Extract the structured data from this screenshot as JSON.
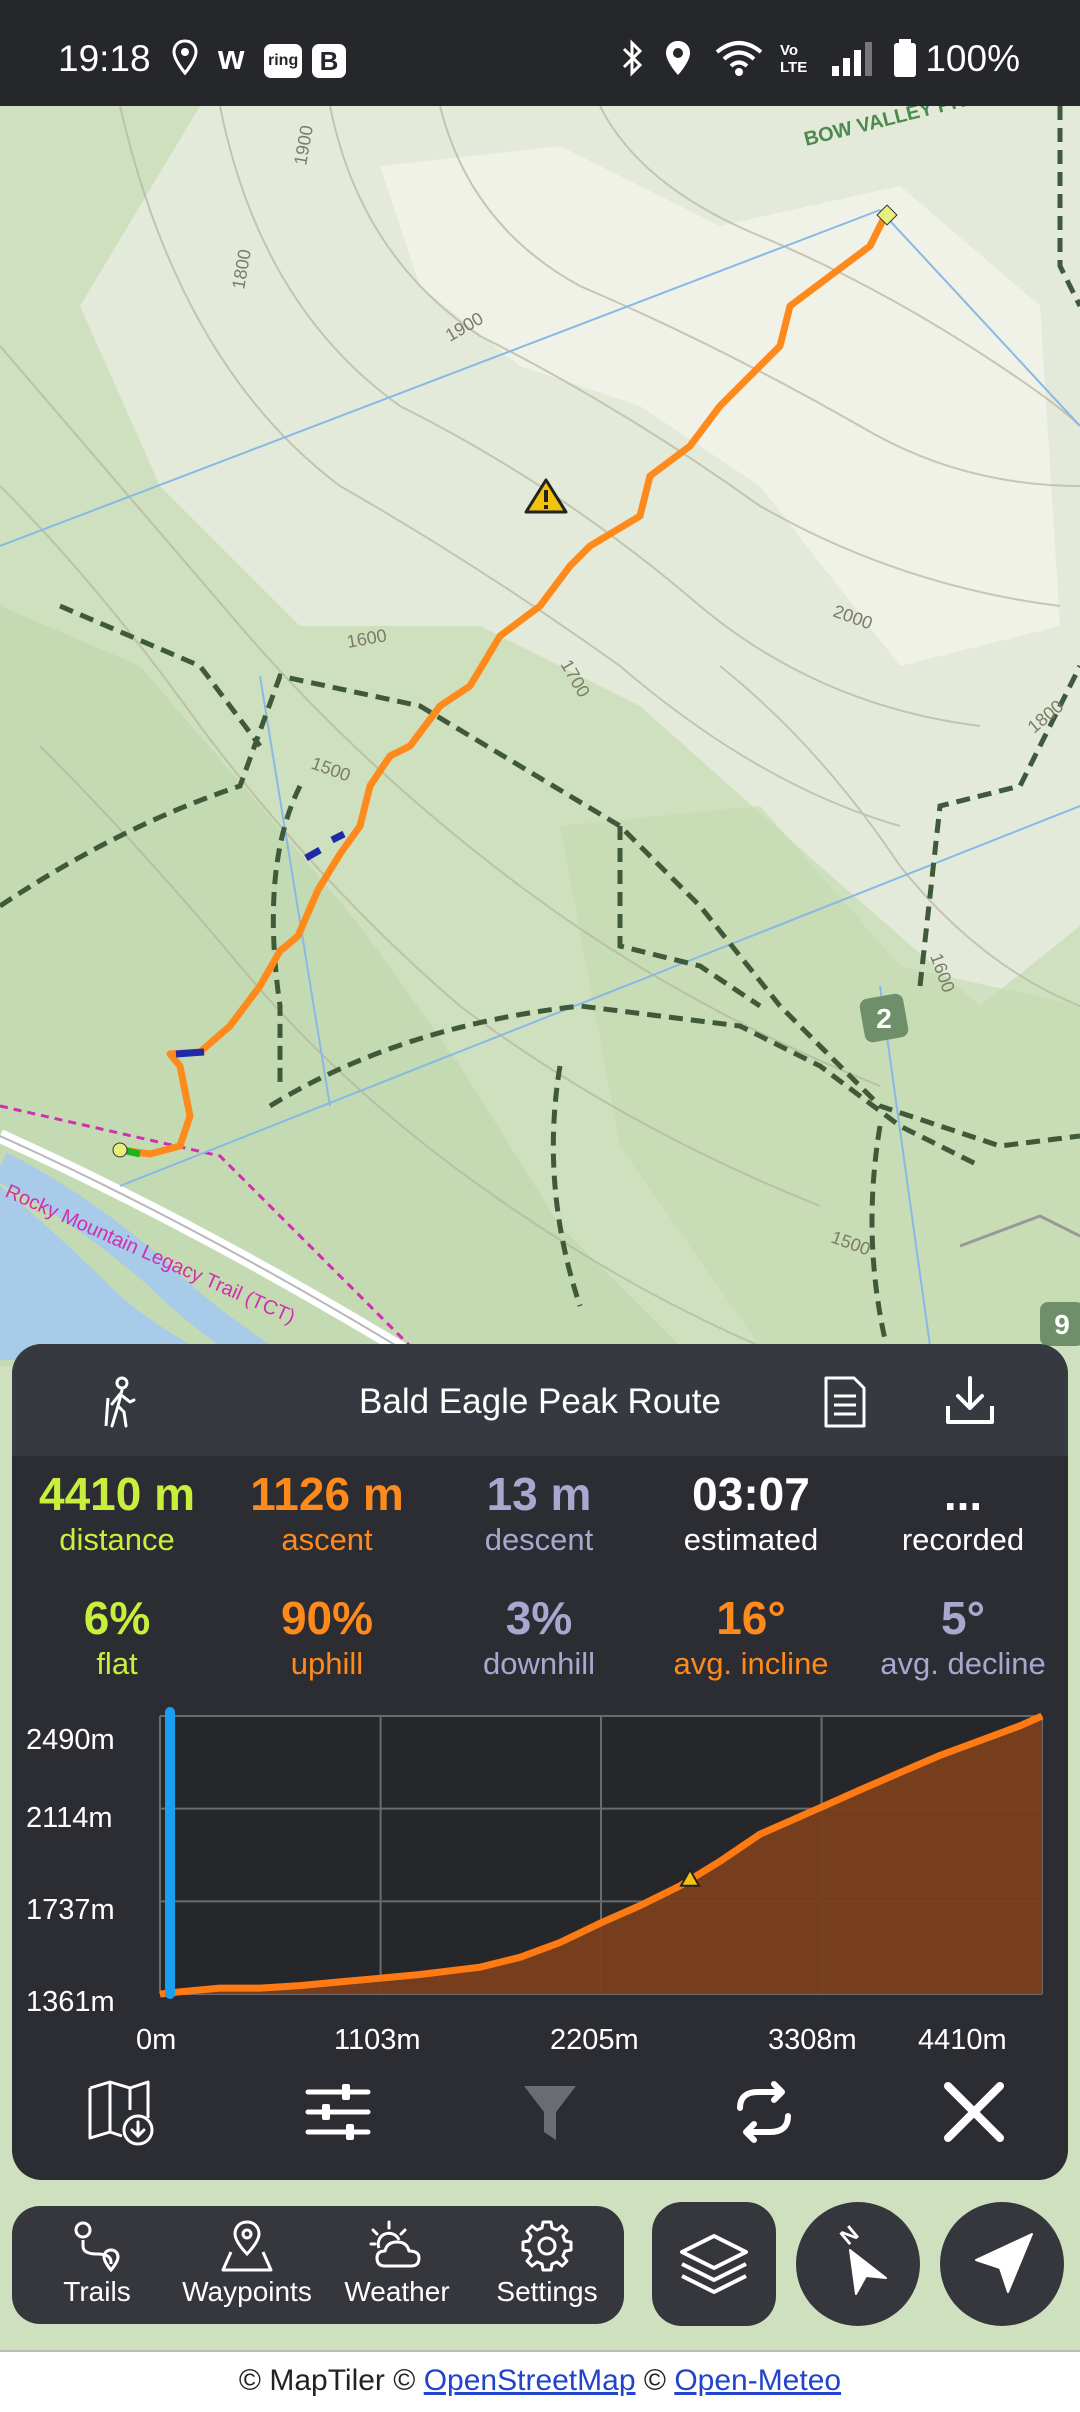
{
  "status_bar": {
    "time": "19:18",
    "left_icons": [
      "location-pin-icon",
      "w-icon",
      "ring-icon",
      "b-icon"
    ],
    "w_label": "w",
    "ring_label": "ring",
    "b_label": "B",
    "volte_label": "Vo\nLTE",
    "battery": "100%"
  },
  "map": {
    "labels": {
      "park": "BOW VALLEY PROVINCIAL PARK",
      "trail": "Rocky Mountain Legacy Trail (TCT)",
      "route_marker": "2",
      "contours": [
        "1900",
        "1800",
        "1900",
        "1600",
        "1700",
        "2000",
        "1800",
        "1500",
        "1600",
        "1500"
      ],
      "right_edge": "9"
    }
  },
  "panel": {
    "title": "Bald Eagle Peak Route",
    "stats_row1": [
      {
        "value": "4410 m",
        "label": "distance",
        "color": "#c8ef3c"
      },
      {
        "value": "1126 m",
        "label": "ascent",
        "color": "#ff8a1c"
      },
      {
        "value": "13 m",
        "label": "descent",
        "color": "#a9a6cf"
      },
      {
        "value": "03:07",
        "label": "estimated",
        "color": "#ffffff"
      },
      {
        "value": "...",
        "label": "recorded",
        "color": "#ffffff"
      }
    ],
    "stats_row2": [
      {
        "value": "6%",
        "label": "flat",
        "color": "#c8ef3c"
      },
      {
        "value": "90%",
        "label": "uphill",
        "color": "#ff8a1c"
      },
      {
        "value": "3%",
        "label": "downhill",
        "color": "#a9a6cf"
      },
      {
        "value": "16°",
        "label": "avg. incline",
        "color": "#ff8a1c"
      },
      {
        "value": "5°",
        "label": "avg. decline",
        "color": "#a9a6cf"
      }
    ]
  },
  "chart_data": {
    "type": "area",
    "title": "",
    "xlabel": "",
    "ylabel": "",
    "x_ticks": [
      "0m",
      "1103m",
      "2205m",
      "3308m",
      "4410m"
    ],
    "y_ticks": [
      "2490m",
      "2114m",
      "1737m",
      "1361m"
    ],
    "xlim": [
      0,
      4410
    ],
    "ylim": [
      1361,
      2490
    ],
    "grid": true,
    "series": [
      {
        "x": [
          0,
          100,
          300,
          500,
          700,
          900,
          1103,
          1300,
          1600,
          1800,
          2000,
          2205,
          2400,
          2600,
          2800,
          3000,
          3308,
          3500,
          3700,
          3900,
          4100,
          4300,
          4410
        ],
        "y": [
          1361,
          1370,
          1385,
          1385,
          1395,
          1410,
          1425,
          1440,
          1470,
          1510,
          1570,
          1650,
          1720,
          1800,
          1900,
          2010,
          2120,
          2190,
          2260,
          2330,
          2390,
          2450,
          2490
        ]
      }
    ],
    "warning_marker_x": 2650
  },
  "toolbar": [
    "offline-map-icon",
    "sliders-icon",
    "filter-icon",
    "sync-icon",
    "close-icon"
  ],
  "nav": [
    {
      "label": "Trails",
      "icon": "trails-icon"
    },
    {
      "label": "Waypoints",
      "icon": "waypoints-icon"
    },
    {
      "label": "Weather",
      "icon": "weather-icon"
    },
    {
      "label": "Settings",
      "icon": "settings-icon"
    }
  ],
  "fab_icons": [
    "layers-icon",
    "compass-north-icon",
    "locate-icon"
  ],
  "compass_letter": "N",
  "attribution": {
    "c1": "© MapTiler ©",
    "osm": "OpenStreetMap",
    "c2": "©",
    "meteo": "Open-Meteo"
  }
}
